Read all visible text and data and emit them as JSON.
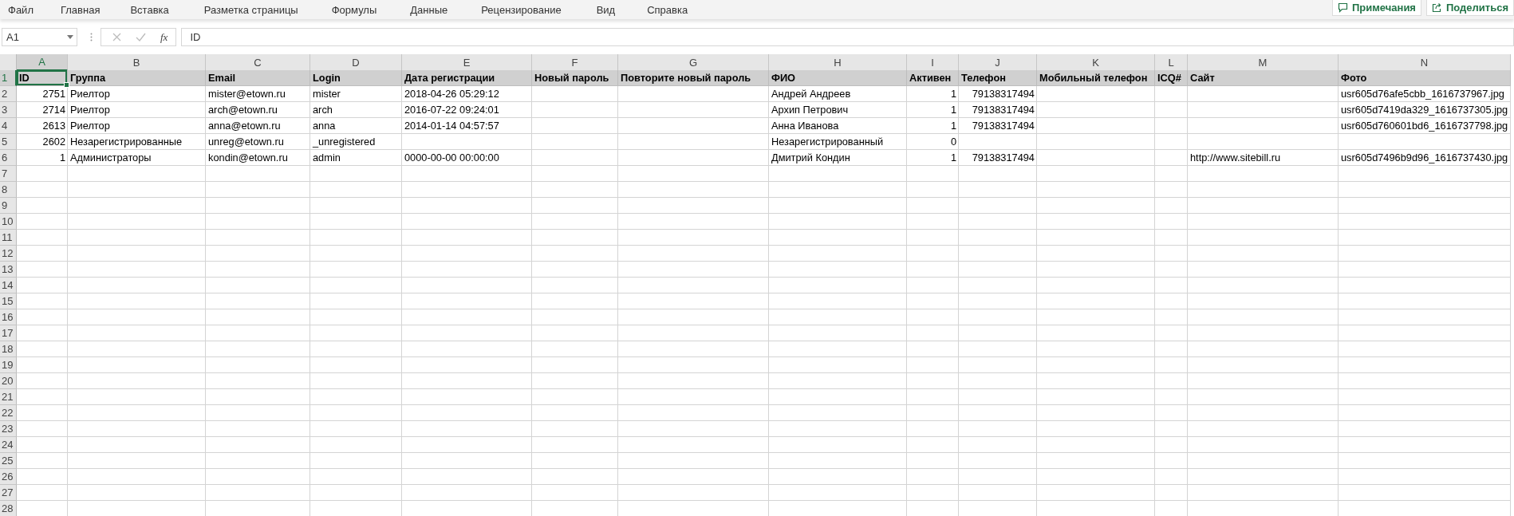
{
  "ribbon": {
    "tabs": [
      {
        "label": "Файл",
        "selected": false
      },
      {
        "label": "Главная",
        "selected": false
      },
      {
        "label": "Вставка",
        "selected": false
      },
      {
        "label": "Разметка страницы",
        "selected": false
      },
      {
        "label": "Формулы",
        "selected": false
      },
      {
        "label": "Данные",
        "selected": false
      },
      {
        "label": "Рецензирование",
        "selected": false
      },
      {
        "label": "Вид",
        "selected": false
      },
      {
        "label": "Справка",
        "selected": false
      }
    ],
    "buttons": [
      {
        "kind": "comments",
        "label": "Примечания"
      },
      {
        "kind": "share",
        "label": "Поделиться"
      }
    ]
  },
  "formula_bar": {
    "name_box": "A1",
    "function_button": "fx",
    "value": "ID"
  },
  "sheet": {
    "columns": [
      {
        "label": "A",
        "numeric": true,
        "selected": true
      },
      {
        "label": "B",
        "numeric": false,
        "selected": false
      },
      {
        "label": "C",
        "numeric": false,
        "selected": false
      },
      {
        "label": "D",
        "numeric": false,
        "selected": false
      },
      {
        "label": "E",
        "numeric": false,
        "selected": false
      },
      {
        "label": "F",
        "numeric": false,
        "selected": false
      },
      {
        "label": "G",
        "numeric": false,
        "selected": false
      },
      {
        "label": "H",
        "numeric": false,
        "selected": false
      },
      {
        "label": "I",
        "numeric": true,
        "selected": false
      },
      {
        "label": "J",
        "numeric": true,
        "selected": false
      },
      {
        "label": "K",
        "numeric": false,
        "selected": false
      },
      {
        "label": "L",
        "numeric": false,
        "selected": false
      },
      {
        "label": "M",
        "numeric": false,
        "selected": false
      },
      {
        "label": "N",
        "numeric": false,
        "selected": false
      }
    ],
    "rows": [
      {
        "header": "1",
        "selected": true,
        "kind": "header",
        "cells": [
          "ID",
          "Группа",
          "Email",
          "Login",
          "Дата регистрации",
          "Новый пароль",
          "Повторите новый пароль",
          "ФИО",
          "Активен",
          "Телефон",
          "Мобильный телефон",
          "ICQ#",
          "Сайт",
          "Фото"
        ]
      },
      {
        "header": "2",
        "selected": false,
        "kind": "data",
        "cells": [
          "2751",
          "Риелтор",
          "mister@etown.ru",
          "mister",
          "2018-04-26 05:29:12",
          null,
          null,
          "Андрей Андреев",
          "1",
          "79138317494",
          null,
          null,
          null,
          "usr605d76afe5cbb_1616737967.jpg"
        ]
      },
      {
        "header": "3",
        "selected": false,
        "kind": "data",
        "cells": [
          "2714",
          "Риелтор",
          "arch@etown.ru",
          "arch",
          "2016-07-22 09:24:01",
          null,
          null,
          "Архип Петрович",
          "1",
          "79138317494",
          null,
          null,
          null,
          "usr605d7419da329_1616737305.jpg"
        ]
      },
      {
        "header": "4",
        "selected": false,
        "kind": "data",
        "cells": [
          "2613",
          "Риелтор",
          "anna@etown.ru",
          "anna",
          "2014-01-14 04:57:57",
          null,
          null,
          "Анна Иванова",
          "1",
          "79138317494",
          null,
          null,
          null,
          "usr605d760601bd6_1616737798.jpg"
        ]
      },
      {
        "header": "5",
        "selected": false,
        "kind": "data",
        "cells": [
          "2602",
          "Незарегистрированные",
          "unreg@etown.ru",
          "_unregistered",
          null,
          null,
          null,
          "Незарегистрированный",
          "0",
          null,
          null,
          null,
          null,
          null
        ]
      },
      {
        "header": "6",
        "selected": false,
        "kind": "data",
        "cells": [
          "1",
          "Администраторы",
          "kondin@etown.ru",
          "admin",
          "0000-00-00 00:00:00",
          null,
          null,
          "Дмитрий Кондин",
          "1",
          "79138317494",
          null,
          null,
          "http://www.sitebill.ru",
          "usr605d7496b9d96_1616737430.jpg"
        ]
      },
      {
        "header": "7",
        "selected": false,
        "kind": "data"
      },
      {
        "header": "8",
        "selected": false,
        "kind": "data"
      },
      {
        "header": "9",
        "selected": false,
        "kind": "data"
      },
      {
        "header": "10",
        "selected": false,
        "kind": "data"
      },
      {
        "header": "11",
        "selected": false,
        "kind": "data"
      },
      {
        "header": "12",
        "selected": false,
        "kind": "data"
      },
      {
        "header": "13",
        "selected": false,
        "kind": "data"
      },
      {
        "header": "14",
        "selected": false,
        "kind": "data"
      },
      {
        "header": "15",
        "selected": false,
        "kind": "data"
      },
      {
        "header": "16",
        "selected": false,
        "kind": "data"
      },
      {
        "header": "17",
        "selected": false,
        "kind": "data"
      },
      {
        "header": "18",
        "selected": false,
        "kind": "data"
      },
      {
        "header": "19",
        "selected": false,
        "kind": "data"
      },
      {
        "header": "20",
        "selected": false,
        "kind": "data"
      },
      {
        "header": "21",
        "selected": false,
        "kind": "data"
      },
      {
        "header": "22",
        "selected": false,
        "kind": "data"
      },
      {
        "header": "23",
        "selected": false,
        "kind": "data"
      },
      {
        "header": "24",
        "selected": false,
        "kind": "data"
      },
      {
        "header": "25",
        "selected": false,
        "kind": "data"
      },
      {
        "header": "26",
        "selected": false,
        "kind": "data"
      },
      {
        "header": "27",
        "selected": false,
        "kind": "data"
      },
      {
        "header": "28",
        "selected": false,
        "kind": "data"
      }
    ]
  }
}
